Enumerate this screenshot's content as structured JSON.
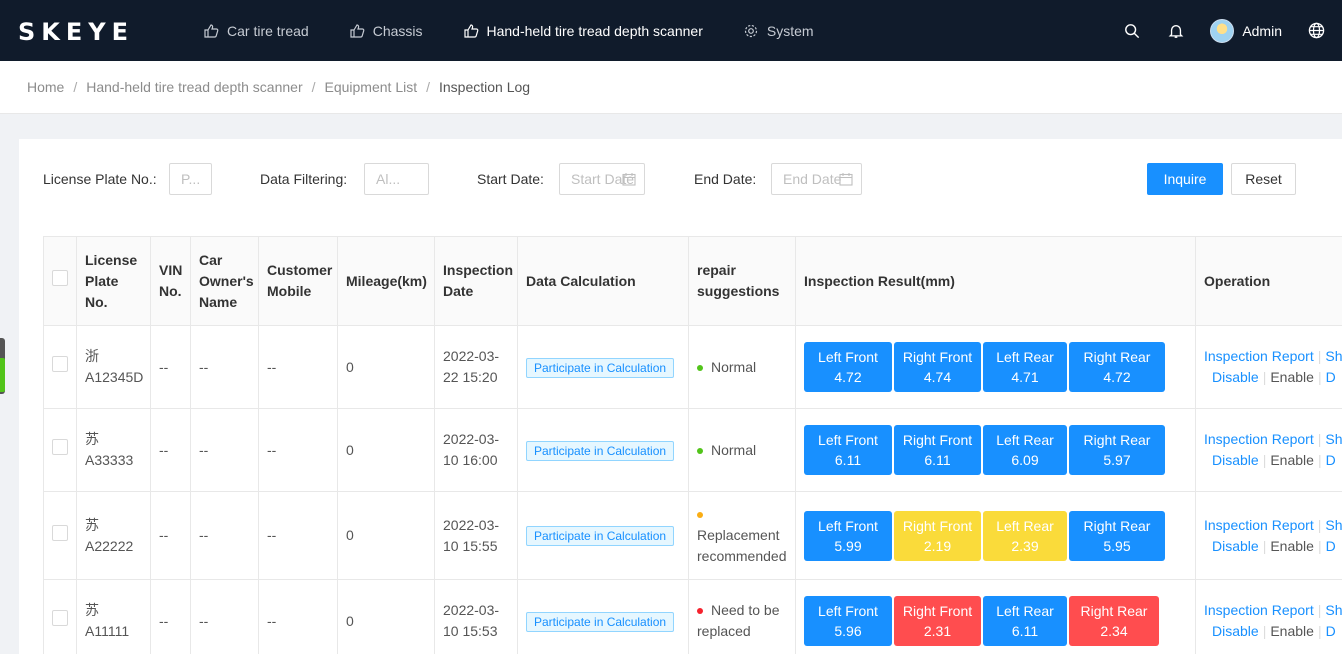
{
  "brand": {
    "logo_text": "SKEYE"
  },
  "nav": [
    {
      "label": "Car tire tread",
      "active": false
    },
    {
      "label": "Chassis",
      "active": false
    },
    {
      "label": "Hand-held tire tread depth scanner",
      "active": true
    },
    {
      "label": "System",
      "active": false
    }
  ],
  "user": {
    "name": "Admin"
  },
  "breadcrumb": [
    "Home",
    "Hand-held tire tread depth scanner",
    "Equipment List",
    "Inspection Log"
  ],
  "filters": {
    "plate_label": "License Plate No.:",
    "plate_placeholder": "P...",
    "filtering_label": "Data Filtering:",
    "filtering_value": "Al...",
    "start_label": "Start Date:",
    "start_placeholder": "Start Date",
    "end_label": "End Date:",
    "end_placeholder": "End Date",
    "inquire": "Inquire",
    "reset": "Reset"
  },
  "table": {
    "headers": {
      "plate": "License Plate No.",
      "vin": "VIN No.",
      "owner": "Car Owner's Name",
      "mobile": "Customer Mobile",
      "mileage": "Mileage(km)",
      "date": "Inspection Date",
      "calc": "Data Calculation",
      "repair": "repair suggestions",
      "result": "Inspection Result(mm)",
      "operation": "Operation"
    },
    "rows": [
      {
        "plate_region": "浙",
        "plate_no": "A12345D",
        "vin": "--",
        "owner": "--",
        "mobile": "--",
        "mileage": "0",
        "date": "2022-03-22 15:20",
        "calc": "Participate in Calculation",
        "repair": "Normal",
        "lf_label": "Left Front",
        "lf": "4.72",
        "rf_label": "Right Front",
        "rf": "4.74",
        "lr_label": "Left Rear",
        "lr": "4.71",
        "rr_label": "Right Rear",
        "rr": "4.72",
        "report": "Inspection Report",
        "sh": "Sh",
        "disable": "Disable",
        "enable": "Enable",
        "d": "D"
      },
      {
        "plate_region": "苏",
        "plate_no": "A33333",
        "vin": "--",
        "owner": "--",
        "mobile": "--",
        "mileage": "0",
        "date": "2022-03-10 16:00",
        "calc": "Participate in Calculation",
        "repair": "Normal",
        "lf_label": "Left Front",
        "lf": "6.11",
        "rf_label": "Right Front",
        "rf": "6.11",
        "lr_label": "Left Rear",
        "lr": "6.09",
        "rr_label": "Right Rear",
        "rr": "5.97",
        "report": "Inspection Report",
        "sh": "Sh",
        "disable": "Disable",
        "enable": "Enable",
        "d": "D"
      },
      {
        "plate_region": "苏",
        "plate_no": "A22222",
        "vin": "--",
        "owner": "--",
        "mobile": "--",
        "mileage": "0",
        "date": "2022-03-10 15:55",
        "calc": "Participate in Calculation",
        "repair": "Replacement recommended",
        "lf_label": "Left Front",
        "lf": "5.99",
        "rf_label": "Right Front",
        "rf": "2.19",
        "lr_label": "Left Rear",
        "lr": "2.39",
        "rr_label": "Right Rear",
        "rr": "5.95",
        "report": "Inspection Report",
        "sh": "Sh",
        "disable": "Disable",
        "enable": "Enable",
        "d": "D"
      },
      {
        "plate_region": "苏",
        "plate_no": "A11111",
        "vin": "--",
        "owner": "--",
        "mobile": "--",
        "mileage": "0",
        "date": "2022-03-10 15:53",
        "calc": "Participate in Calculation",
        "repair": "Need to be replaced",
        "lf_label": "Left Front",
        "lf": "5.96",
        "rf_label": "Right Front",
        "rf": "2.31",
        "lr_label": "Left Rear",
        "lr": "6.11",
        "rr_label": "Right Rear",
        "rr": "2.34",
        "report": "Inspection Report",
        "sh": "Sh",
        "disable": "Disable",
        "enable": "Enable",
        "d": "D"
      }
    ]
  },
  "colors": {
    "primary": "#1890ff",
    "normal": "#52c41a",
    "warning": "#faad14",
    "danger": "#ff4d4f",
    "topbar": "#101b2b",
    "cell_yellow": "#fadb3a"
  }
}
